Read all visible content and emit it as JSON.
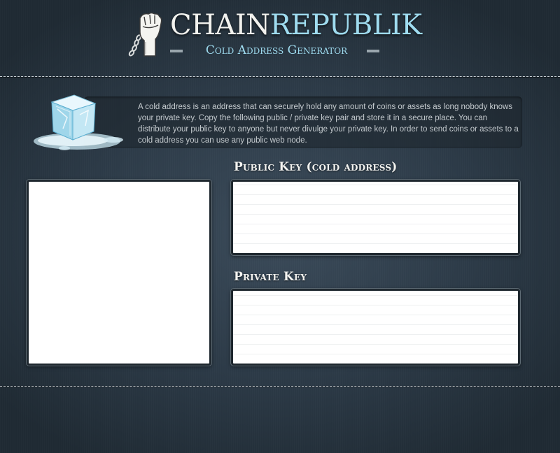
{
  "header": {
    "logo_part1": "CHAIN",
    "logo_part2": "REPUBLIK",
    "subtitle": "Cold Address Generator"
  },
  "info": {
    "text": "A cold address is an address that can securely hold any amount of coins or assets as long nobody knows your private key. Copy the following public / private key pair and store it in a secure place. You can distribute your public key to anyone but never divulge your private key. In order to send coins or assets to a cold address you can use any public web node."
  },
  "public_key": {
    "label": "Public Key (cold address)",
    "value": ""
  },
  "private_key": {
    "label": "Private Key",
    "value": ""
  },
  "icons": {
    "logo": "raised-fist-chain-icon",
    "info": "ice-cube-icon"
  },
  "colors": {
    "accent": "#9fdcf0",
    "background": "#2c3a47",
    "text_light": "#f2f2ee"
  }
}
